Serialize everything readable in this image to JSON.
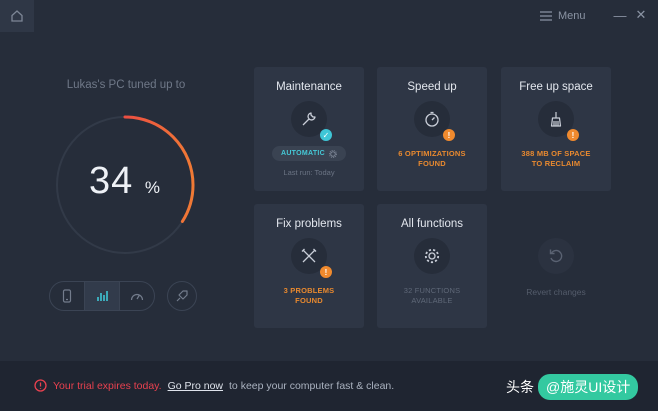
{
  "window": {
    "menu_label": "Menu",
    "minimize_glyph": "—",
    "close_glyph": "✕"
  },
  "gauge": {
    "title": "Lukas's PC tuned up to",
    "value": "34",
    "unit": "%",
    "fraction": 0.34,
    "colors": {
      "start": "#e8234f",
      "end": "#f07a35",
      "track": "#323a48"
    }
  },
  "bottom_controls": {
    "items": [
      "phone-icon",
      "bar-chart-icon",
      "speedometer-icon"
    ],
    "active_index": 1,
    "extra": "rocket-icon"
  },
  "tiles": {
    "maintenance": {
      "title": "Maintenance",
      "status": "AUTOMATIC",
      "last_run": "Last run: Today"
    },
    "speed_up": {
      "title": "Speed up",
      "status_line1": "6 OPTIMIZATIONS",
      "status_line2": "FOUND"
    },
    "free_up_space": {
      "title": "Free up space",
      "status_line1": "388 MB OF SPACE",
      "status_line2": "TO RECLAIM"
    },
    "fix_problems": {
      "title": "Fix problems",
      "status_line1": "3 PROBLEMS",
      "status_line2": "FOUND"
    },
    "all_functions": {
      "title": "All functions",
      "status_line1": "32 FUNCTIONS",
      "status_line2": "AVAILABLE"
    },
    "revert": {
      "label": "Revert changes"
    }
  },
  "footer": {
    "warning": "Your trial expires today.",
    "link": "Go Pro now",
    "rest": "to keep your computer fast & clean."
  },
  "watermark": {
    "prefix": "头条",
    "handle": "@施灵UI设计"
  },
  "colors": {
    "accent_orange": "#e8892f",
    "accent_cyan": "#3fc6d6",
    "warning_red": "#e8414f"
  }
}
